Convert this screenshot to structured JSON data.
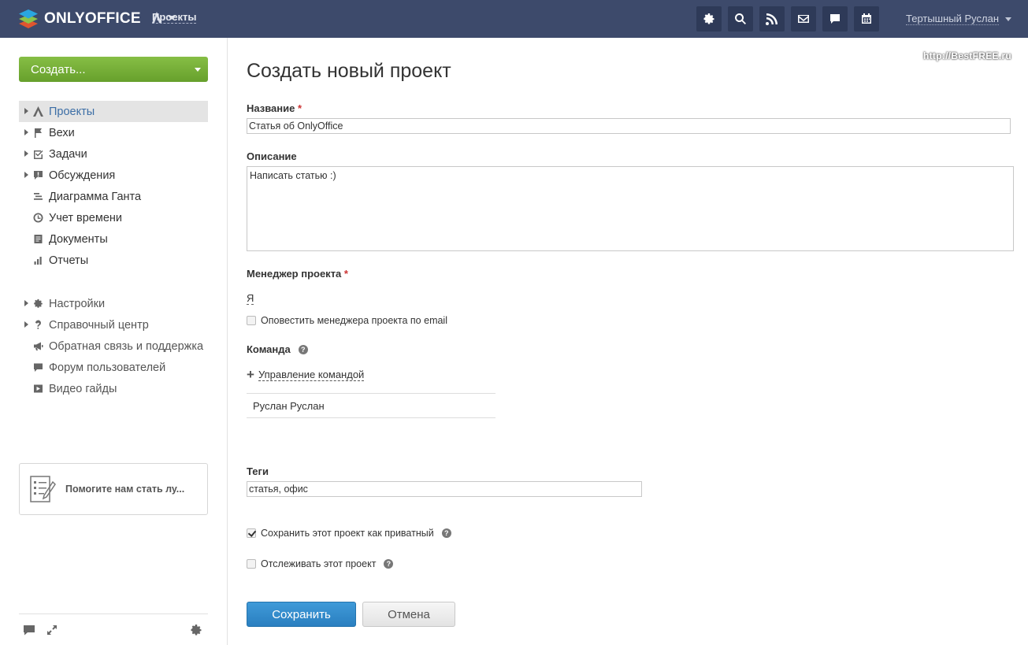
{
  "header": {
    "logo_text": "ONLYOFFICE",
    "module_label": "Проекты",
    "user_name": "Тертышный Руслан",
    "icons": [
      "settings-icon",
      "search-icon",
      "feed-icon",
      "mail-icon",
      "chat-icon",
      "calendar-icon"
    ]
  },
  "watermark": "http://BestFREE.ru",
  "sidebar": {
    "create_label": "Создать...",
    "nav": [
      {
        "label": "Проекты",
        "icon": "projects-icon",
        "expandable": true,
        "active": true
      },
      {
        "label": "Вехи",
        "icon": "flag-icon",
        "expandable": true
      },
      {
        "label": "Задачи",
        "icon": "checkbox-icon",
        "expandable": true
      },
      {
        "label": "Обсуждения",
        "icon": "discussion-icon",
        "expandable": true
      },
      {
        "label": "Диаграмма Ганта",
        "icon": "gantt-icon",
        "expandable": false
      },
      {
        "label": "Учет времени",
        "icon": "clock-icon",
        "expandable": false
      },
      {
        "label": "Документы",
        "icon": "documents-icon",
        "expandable": false
      },
      {
        "label": "Отчеты",
        "icon": "reports-icon",
        "expandable": false
      }
    ],
    "nav2": [
      {
        "label": "Настройки",
        "icon": "gear-icon",
        "expandable": true
      },
      {
        "label": "Справочный центр",
        "icon": "help-icon",
        "expandable": true
      },
      {
        "label": "Обратная связь и поддержка",
        "icon": "megaphone-icon",
        "expandable": false
      },
      {
        "label": "Форум пользователей",
        "icon": "forum-icon",
        "expandable": false
      },
      {
        "label": "Видео гайды",
        "icon": "video-icon",
        "expandable": false
      }
    ],
    "promo_text": "Помогите нам стать лу..."
  },
  "form": {
    "title": "Создать новый проект",
    "name_label": "Название",
    "required_mark": "*",
    "name_value": "Статья об OnlyOffice",
    "description_label": "Описание",
    "description_value": "Написать статью :)",
    "manager_label": "Менеджер проекта",
    "manager_value": "Я",
    "notify_label": "Оповестить менеджера проекта по email",
    "notify_checked": false,
    "team_label": "Команда",
    "team_manage_label": "Управление командой",
    "team_members": [
      "Руслан Руслан"
    ],
    "tags_label": "Теги",
    "tags_value": "статья, офис",
    "private_label": "Сохранить этот проект как приватный",
    "private_checked": true,
    "follow_label": "Отслеживать этот проект",
    "follow_checked": false,
    "save_label": "Сохранить",
    "cancel_label": "Отмена",
    "help_glyph": "?"
  }
}
